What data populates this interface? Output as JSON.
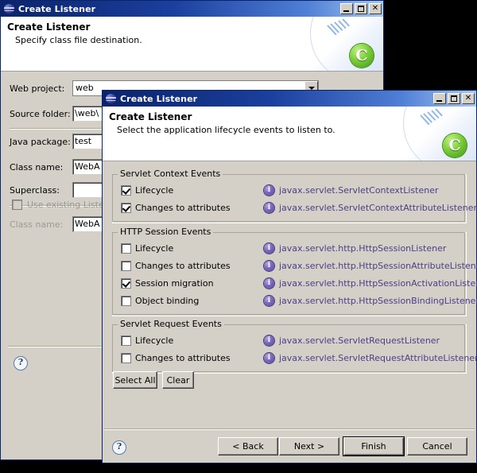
{
  "background_window": {
    "title": "Create Listener",
    "app_icon": "globe-icon",
    "window_buttons": {
      "minimize": "minimize-icon",
      "maximize": "maximize-icon",
      "close": "close-icon"
    },
    "banner": {
      "title": "Create Listener",
      "subtitle": "Specify class file destination.",
      "logo": "green-c-logo"
    },
    "fields": [
      {
        "label": "Web project:",
        "value": "web",
        "type": "combo"
      },
      {
        "label": "Source folder:",
        "value": "\\web\\",
        "type": "text"
      },
      {
        "label": "Java package:",
        "value": "test",
        "type": "text"
      },
      {
        "label": "Class name:",
        "value": "WebA",
        "type": "text"
      },
      {
        "label": "Superclass:",
        "value": "",
        "type": "text"
      }
    ],
    "use_existing": {
      "label": "Use existing Listener",
      "checked": false,
      "disabled": true
    },
    "existing_class": {
      "label": "Class name:",
      "value": "WebA",
      "disabled": true
    },
    "help_icon": "help-icon"
  },
  "foreground_dialog": {
    "title": "Create Listener",
    "app_icon": "globe-icon",
    "window_buttons": {
      "minimize": "minimize-icon",
      "maximize": "maximize-icon",
      "close": "close-icon"
    },
    "banner": {
      "title": "Create Listener",
      "subtitle": "Select the application lifecycle events to listen to.",
      "logo": "green-c-logo"
    },
    "groups": [
      {
        "legend": "Servlet Context Events",
        "rows": [
          {
            "label": "Lifecycle",
            "checked": true,
            "listener": "javax.servlet.ServletContextListener"
          },
          {
            "label": "Changes to attributes",
            "checked": true,
            "listener": "javax.servlet.ServletContextAttributeListener"
          }
        ]
      },
      {
        "legend": "HTTP Session Events",
        "rows": [
          {
            "label": "Lifecycle",
            "checked": false,
            "listener": "javax.servlet.http.HttpSessionListener"
          },
          {
            "label": "Changes to attributes",
            "checked": false,
            "listener": "javax.servlet.http.HttpSessionAttributeListener"
          },
          {
            "label": "Session migration",
            "checked": true,
            "listener": "javax.servlet.http.HttpSessionActivationListener"
          },
          {
            "label": "Object binding",
            "checked": false,
            "listener": "javax.servlet.http.HttpSessionBindingListener"
          }
        ]
      },
      {
        "legend": "Servlet Request Events",
        "rows": [
          {
            "label": "Lifecycle",
            "checked": false,
            "listener": "javax.servlet.ServletRequestListener"
          },
          {
            "label": "Changes to attributes",
            "checked": false,
            "listener": "javax.servlet.ServletRequestAttributeListener"
          }
        ]
      }
    ],
    "select_all_label": "Select All",
    "clear_label": "Clear",
    "nav_buttons": {
      "back": "< Back",
      "next": "Next >",
      "finish": "Finish",
      "cancel": "Cancel"
    },
    "help_icon": "help-icon"
  },
  "colors": {
    "face": "#d4d0c8",
    "title_start": "#0a246a",
    "title_end": "#a6c8f0",
    "listener_text": "#4b3f86",
    "info_icon": "#5b4a9c",
    "logo_green": "#7fd13b"
  }
}
